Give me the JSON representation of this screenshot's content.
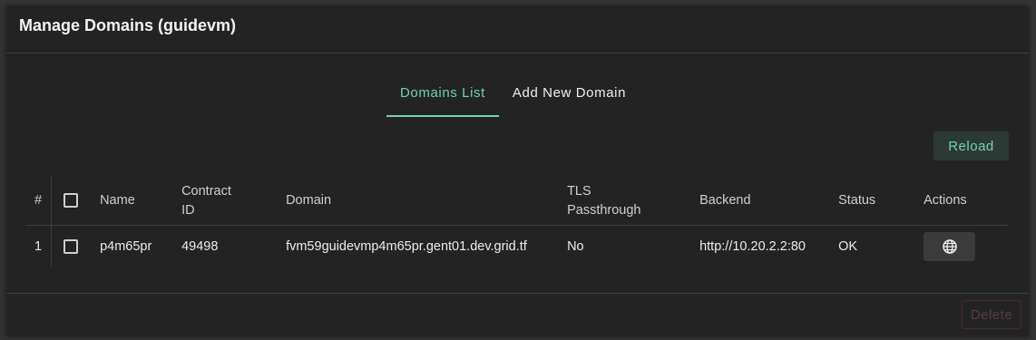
{
  "dialog": {
    "title": "Manage Domains (guidevm)"
  },
  "tabs": [
    {
      "label": "Domains List",
      "active": true
    },
    {
      "label": "Add New Domain",
      "active": false
    }
  ],
  "toolbar": {
    "reload_label": "Reload"
  },
  "table": {
    "headers": {
      "index": "#",
      "name": "Name",
      "contract_id_line1": "Contract",
      "contract_id_line2": "ID",
      "domain": "Domain",
      "tls_line1": "TLS",
      "tls_line2": "Passthrough",
      "backend": "Backend",
      "status": "Status",
      "actions": "Actions"
    },
    "rows": [
      {
        "index": "1",
        "name": "p4m65pr",
        "contract_id": "49498",
        "domain": "fvm59guidevmp4m65pr.gent01.dev.grid.tf",
        "tls_passthrough": "No",
        "backend": "http://10.20.2.2:80",
        "status": "OK",
        "action_icon": "globe-icon"
      }
    ]
  },
  "footer": {
    "delete_label": "Delete"
  },
  "colors": {
    "accent": "#6fd3b3",
    "dialog_bg": "#232323",
    "delete_disabled": "#5a3a3e"
  }
}
